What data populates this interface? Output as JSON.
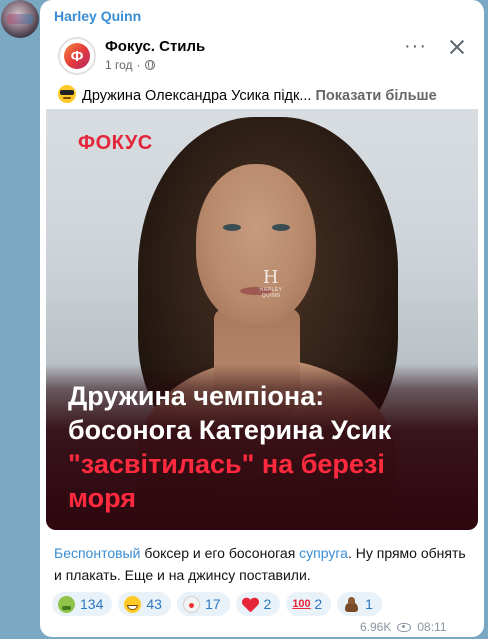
{
  "message": {
    "sender": "Harley Quinn",
    "views": "6.96K",
    "time": "08:11",
    "caption": {
      "link1": "Беспонтовый",
      "text1": " боксер и его босоногая ",
      "link2": "супруга",
      "text2": ". Ну прямо обнять и плакать. Еще и на джинсу поставили."
    },
    "reactions": [
      {
        "icon": "nauseated-face-icon",
        "count": "134"
      },
      {
        "icon": "grinning-face-icon",
        "count": "43"
      },
      {
        "icon": "clown-face-icon",
        "count": "17"
      },
      {
        "icon": "red-heart-icon",
        "count": "2"
      },
      {
        "icon": "hundred-points-icon",
        "count": "2"
      },
      {
        "icon": "pile-of-poo-icon",
        "count": "1"
      }
    ]
  },
  "post": {
    "page_name": "Фокус. Стиль",
    "logo_letter": "Ф",
    "time_ago": "1 год",
    "separator": "·",
    "text": "Дружина Олександра Усика підк...",
    "show_more": "Показати більше"
  },
  "photo": {
    "brand": "ФОКУС",
    "watermark_mark": "H",
    "watermark_text": "HARLEY QUINN",
    "headline_line1": "Дружина чемпіона:",
    "headline_line2": "босонога Катерина Усик",
    "headline_accent": "\"засвітилась\"",
    "headline_line3_rest": " на березі",
    "headline_line4": "моря"
  },
  "colors": {
    "chat_background": "#7aa7c2",
    "link_blue": "#3a8dd4",
    "brand_red": "#e3263a",
    "reaction_bg": "#e9f2f8"
  }
}
